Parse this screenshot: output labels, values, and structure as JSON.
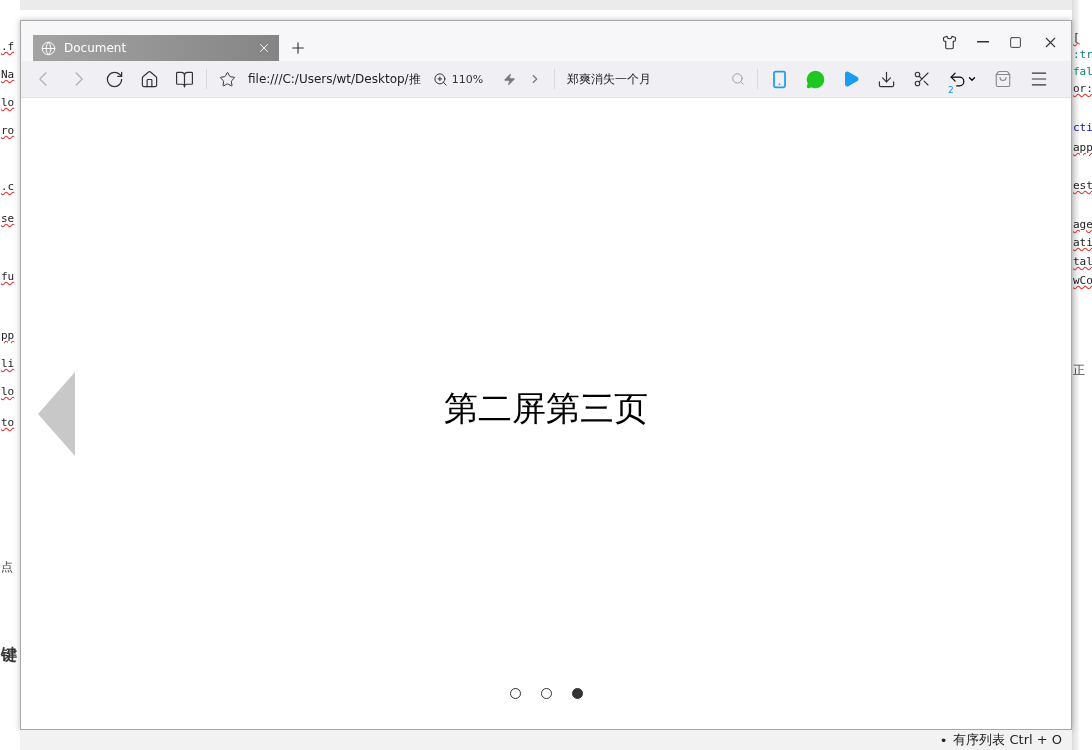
{
  "background": {
    "left_fragments": [
      {
        "text": ".f",
        "kind": "code"
      },
      {
        "text": "Na",
        "kind": "code"
      },
      {
        "text": "lo",
        "kind": "code"
      },
      {
        "text": "ro",
        "kind": "code"
      },
      {
        "text": ".c",
        "kind": "code"
      },
      {
        "text": "se",
        "kind": "code"
      },
      {
        "text": "fu",
        "kind": "code"
      },
      {
        "text": "pp",
        "kind": "code"
      },
      {
        "text": "li",
        "kind": "code"
      },
      {
        "text": "lo",
        "kind": "code"
      },
      {
        "text": "to",
        "kind": "code"
      },
      {
        "text": "点",
        "kind": "text"
      },
      {
        "text": "键",
        "kind": "heading"
      }
    ],
    "right_fragments": [
      {
        "text": "[",
        "kind": "code"
      },
      {
        "text": ":tr",
        "kind": "value"
      },
      {
        "text": "fal",
        "kind": "value"
      },
      {
        "text": "or:",
        "kind": "code"
      },
      {
        "text": "cti",
        "kind": "keyword"
      },
      {
        "text": "app",
        "kind": "code"
      },
      {
        "text": "est",
        "kind": "code"
      },
      {
        "text": "age",
        "kind": "code"
      },
      {
        "text": "ati",
        "kind": "code"
      },
      {
        "text": "tal",
        "kind": "code"
      },
      {
        "text": "wCo",
        "kind": "code"
      },
      {
        "text": "正",
        "kind": "text"
      }
    ],
    "status_bullet": "•",
    "status_text": "有序列表 Ctrl + O"
  },
  "browser": {
    "tabs": [
      {
        "title": "Document",
        "selected": true
      }
    ],
    "nav": {
      "back_disabled": true,
      "forward_disabled": true
    },
    "url": "file:///C:/Users/wt/Desktop/推",
    "zoom": "110%",
    "search": {
      "value": "郑爽消失一个月"
    },
    "undo_badge": "2",
    "slide": {
      "text": "第二屏第三页",
      "dots": [
        {
          "selected": false
        },
        {
          "selected": false
        },
        {
          "selected": true
        }
      ]
    }
  }
}
